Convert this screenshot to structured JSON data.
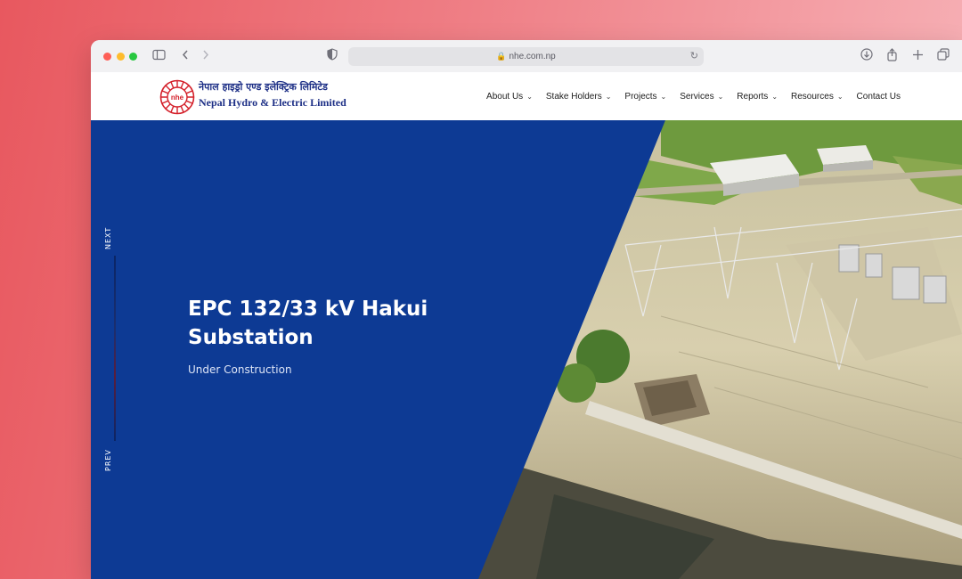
{
  "browser": {
    "url": "nhe.com.np"
  },
  "logo": {
    "mark_text": "nhe",
    "name_nepali": "नेपाल हाइड्रो एण्ड इलेक्ट्रिक लिमिटेड",
    "name_english": "Nepal Hydro & Electric Limited"
  },
  "nav": [
    {
      "label": "About Us",
      "has_dropdown": true
    },
    {
      "label": "Stake Holders",
      "has_dropdown": true
    },
    {
      "label": "Projects",
      "has_dropdown": true
    },
    {
      "label": "Services",
      "has_dropdown": true
    },
    {
      "label": "Reports",
      "has_dropdown": true
    },
    {
      "label": "Resources",
      "has_dropdown": true
    },
    {
      "label": "Contact Us",
      "has_dropdown": false
    }
  ],
  "hero": {
    "title": "EPC 132/33 kV Hakui Substation",
    "subtitle": "Under Construction",
    "next_label": "NEXT",
    "prev_label": "PREV"
  },
  "colors": {
    "brand_blue": "#0d3a94",
    "logo_red": "#d4202a",
    "logo_blue": "#1d2f86"
  }
}
